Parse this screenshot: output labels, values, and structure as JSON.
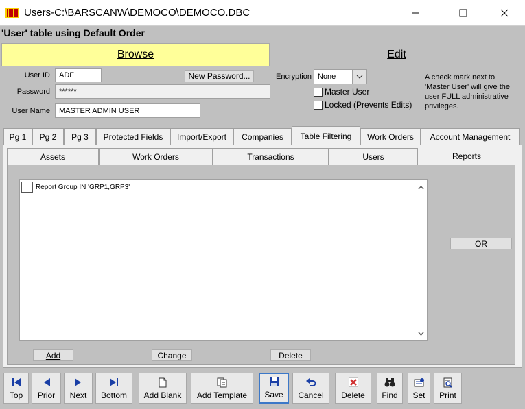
{
  "window": {
    "title": "Users-C:\\BARSCANW\\DEMOCO\\DEMOCO.DBC"
  },
  "caption": "'User' table using Default Order",
  "mode_tabs": {
    "browse": "Browse",
    "edit": "Edit"
  },
  "form": {
    "user_id_label": "User ID",
    "user_id_value": "ADF",
    "password_label": "Password",
    "password_value": "******",
    "user_name_label": "User Name",
    "user_name_value": "MASTER ADMIN USER",
    "new_password_button": "New Password...",
    "encryption_label": "Encryption",
    "encryption_value": "None",
    "master_user_label": "Master User",
    "locked_label": "Locked (Prevents Edits)",
    "note": "A check mark next to 'Master User' will give the user FULL administrative privileges."
  },
  "page_tabs": [
    "Pg 1",
    "Pg 2",
    "Pg 3",
    "Protected Fields",
    "Import/Export",
    "Companies",
    "Table Filtering",
    "Work Orders",
    "Account Management"
  ],
  "active_page_tab": "Table Filtering",
  "sub_tabs": [
    "Assets",
    "Work Orders",
    "Transactions",
    "Users",
    "Reports"
  ],
  "active_sub_tab": "Reports",
  "filter_list": {
    "items": [
      {
        "label": "Report Group IN 'GRP1,GRP3'",
        "checked": false
      }
    ]
  },
  "or_button": "OR",
  "list_buttons": {
    "add": "Add",
    "change": "Change",
    "delete": "Delete"
  },
  "toolbar": {
    "top": "Top",
    "prior": "Prior",
    "next": "Next",
    "bottom": "Bottom",
    "add_blank": "Add Blank",
    "add_template": "Add Template",
    "save": "Save",
    "cancel": "Cancel",
    "delete": "Delete",
    "find": "Find",
    "set": "Set",
    "print": "Print"
  },
  "colors": {
    "browse_tab": "#ffff99",
    "window_bg": "#c0c0c0",
    "nav_icon": "#1a3fa6",
    "delete_icon": "#d03030",
    "active_border": "#3c78c8"
  }
}
